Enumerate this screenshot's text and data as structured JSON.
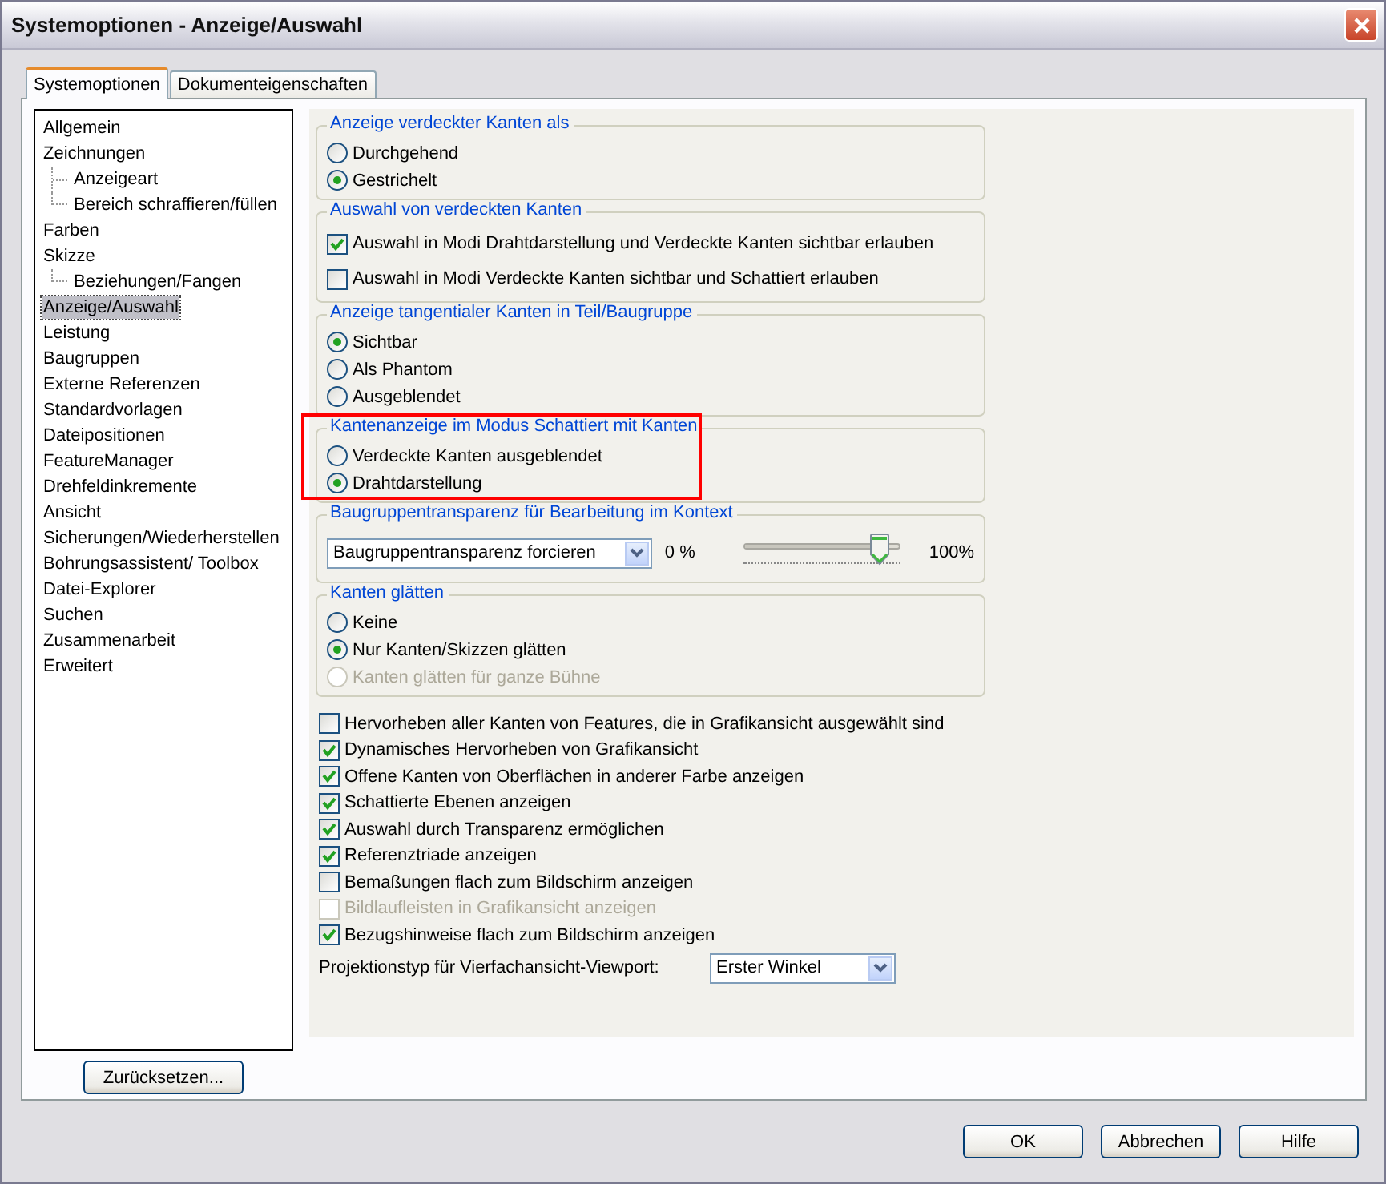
{
  "window": {
    "title": "Systemoptionen - Anzeige/Auswahl"
  },
  "tabs": [
    {
      "label": "Systemoptionen",
      "selected": true
    },
    {
      "label": "Dokumenteigenschaften",
      "selected": false
    }
  ],
  "tree": [
    {
      "label": "Allgemein",
      "selected": false
    },
    {
      "label": "Zeichnungen",
      "selected": false,
      "children": [
        {
          "label": "Anzeigeart",
          "selected": false
        },
        {
          "label": "Bereich schraffieren/füllen",
          "selected": false
        }
      ]
    },
    {
      "label": "Farben",
      "selected": false
    },
    {
      "label": "Skizze",
      "selected": false,
      "children": [
        {
          "label": "Beziehungen/Fangen",
          "selected": false
        }
      ]
    },
    {
      "label": "Anzeige/Auswahl",
      "selected": true
    },
    {
      "label": "Leistung",
      "selected": false
    },
    {
      "label": "Baugruppen",
      "selected": false
    },
    {
      "label": "Externe Referenzen",
      "selected": false
    },
    {
      "label": "Standardvorlagen",
      "selected": false
    },
    {
      "label": "Dateipositionen",
      "selected": false
    },
    {
      "label": "FeatureManager",
      "selected": false
    },
    {
      "label": "Drehfeldinkremente",
      "selected": false
    },
    {
      "label": "Ansicht",
      "selected": false
    },
    {
      "label": "Sicherungen/Wiederherstellen",
      "selected": false
    },
    {
      "label": "Bohrungsassistent/ Toolbox",
      "selected": false
    },
    {
      "label": "Datei-Explorer",
      "selected": false
    },
    {
      "label": "Suchen",
      "selected": false
    },
    {
      "label": "Zusammenarbeit",
      "selected": false
    },
    {
      "label": "Erweitert",
      "selected": false
    }
  ],
  "reset_button": "Zurücksetzen...",
  "groups": [
    {
      "title": "Anzeige verdeckter Kanten als",
      "highlighted": false,
      "items": [
        {
          "kind": "radio",
          "label": "Durchgehend",
          "checked": false,
          "disabled": false
        },
        {
          "kind": "radio",
          "label": "Gestrichelt",
          "checked": true,
          "disabled": false
        }
      ]
    },
    {
      "title": "Auswahl von verdeckten Kanten",
      "highlighted": false,
      "items": [
        {
          "kind": "checkbox",
          "label": "Auswahl in Modi Drahtdarstellung und Verdeckte Kanten sichtbar erlauben",
          "checked": true,
          "disabled": false
        },
        {
          "kind": "checkbox",
          "label": "Auswahl in Modi Verdeckte Kanten sichtbar und Schattiert erlauben",
          "checked": false,
          "disabled": false
        }
      ]
    },
    {
      "title": "Anzeige tangentialer Kanten in Teil/Baugruppe",
      "highlighted": false,
      "items": [
        {
          "kind": "radio",
          "label": "Sichtbar",
          "checked": true,
          "disabled": false
        },
        {
          "kind": "radio",
          "label": "Als Phantom",
          "checked": false,
          "disabled": false
        },
        {
          "kind": "radio",
          "label": "Ausgeblendet",
          "checked": false,
          "disabled": false
        }
      ]
    },
    {
      "title": "Kantenanzeige im Modus Schattiert mit Kanten",
      "highlighted": true,
      "items": [
        {
          "kind": "radio",
          "label": "Verdeckte Kanten ausgeblendet",
          "checked": false,
          "disabled": false
        },
        {
          "kind": "radio",
          "label": "Drahtdarstellung",
          "checked": true,
          "disabled": false
        }
      ]
    },
    {
      "title": "Baugruppentransparenz für Bearbeitung im Kontext",
      "highlighted": false,
      "items": [
        {
          "kind": "transparency",
          "value": "Baugruppentransparenz forcieren",
          "min_label": "0 %",
          "max_label": "100%",
          "level": 0.87
        }
      ]
    },
    {
      "title": "Kanten glätten",
      "highlighted": false,
      "items": [
        {
          "kind": "radio",
          "label": "Keine",
          "checked": false,
          "disabled": false
        },
        {
          "kind": "radio",
          "label": "Nur Kanten/Skizzen glätten",
          "checked": true,
          "disabled": false
        },
        {
          "kind": "radio",
          "label": "Kanten glätten für ganze Bühne",
          "checked": false,
          "disabled": true
        }
      ]
    }
  ],
  "options": [
    {
      "label": "Hervorheben aller Kanten von Features, die in Grafikansicht ausgewählt sind",
      "checked": false,
      "disabled": false
    },
    {
      "label": "Dynamisches Hervorheben von Grafikansicht",
      "checked": true,
      "disabled": false
    },
    {
      "label": "Offene Kanten von Oberflächen in anderer Farbe anzeigen",
      "checked": true,
      "disabled": false
    },
    {
      "label": "Schattierte Ebenen anzeigen",
      "checked": true,
      "disabled": false
    },
    {
      "label": "Auswahl durch Transparenz ermöglichen",
      "checked": true,
      "disabled": false
    },
    {
      "label": "Referenztriade anzeigen",
      "checked": true,
      "disabled": false
    },
    {
      "label": "Bemaßungen flach zum Bildschirm anzeigen",
      "checked": false,
      "disabled": false
    },
    {
      "label": "Bildlaufleisten in Grafikansicht anzeigen",
      "checked": false,
      "disabled": true
    },
    {
      "label": "Bezugshinweise flach zum Bildschirm anzeigen",
      "checked": true,
      "disabled": false
    }
  ],
  "projection": {
    "label": "Projektionstyp für Vierfachansicht-Viewport:",
    "value": "Erster Winkel"
  },
  "buttons": [
    "OK",
    "Abbrechen",
    "Hilfe"
  ]
}
